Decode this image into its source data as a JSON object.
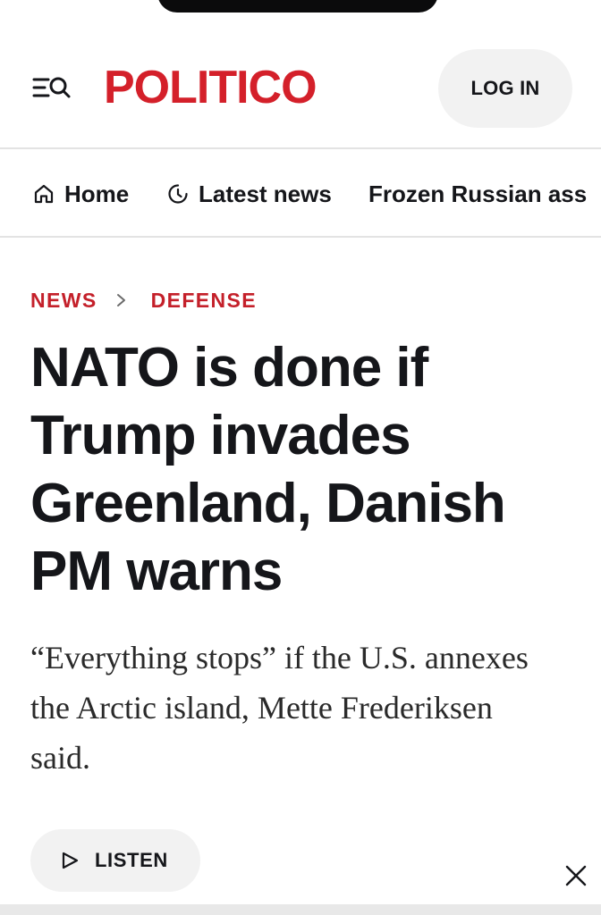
{
  "site": {
    "logo_text": "POLITICO",
    "brand_color": "#d4202a"
  },
  "header": {
    "menu_icon": "menu-search-icon",
    "login_label": "LOG IN"
  },
  "topnav": {
    "items": [
      {
        "label": "Home",
        "icon": "home-icon"
      },
      {
        "label": "Latest news",
        "icon": "clock-icon"
      },
      {
        "label": "Frozen Russian ass"
      }
    ]
  },
  "article": {
    "breadcrumb": [
      "NEWS",
      "DEFENSE"
    ],
    "breadcrumb_color": "#c4202a",
    "headline": "NATO is done if Trump invades Greenland, Danish PM warns",
    "dek": "“Everything stops” if the U.S. annexes the Arctic island, Mette Frederiksen said."
  },
  "audio": {
    "listen_label": "LISTEN",
    "icon": "play-icon"
  },
  "close_icon": "close-icon"
}
